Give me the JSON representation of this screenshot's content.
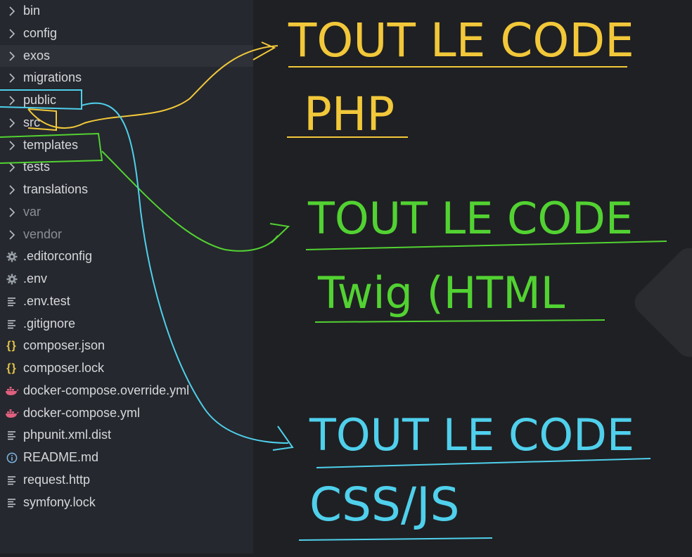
{
  "explorer": {
    "items": [
      {
        "label": "bin",
        "kind": "folder",
        "icon": "chevron-right-icon"
      },
      {
        "label": "config",
        "kind": "folder",
        "icon": "chevron-right-icon"
      },
      {
        "label": "exos",
        "kind": "folder",
        "icon": "chevron-right-icon",
        "active": true
      },
      {
        "label": "migrations",
        "kind": "folder",
        "icon": "chevron-right-icon"
      },
      {
        "label": "public",
        "kind": "folder",
        "icon": "chevron-right-icon"
      },
      {
        "label": "src",
        "kind": "folder",
        "icon": "chevron-right-icon"
      },
      {
        "label": "templates",
        "kind": "folder",
        "icon": "chevron-right-icon"
      },
      {
        "label": "tests",
        "kind": "folder",
        "icon": "chevron-right-icon"
      },
      {
        "label": "translations",
        "kind": "folder",
        "icon": "chevron-right-icon"
      },
      {
        "label": "var",
        "kind": "folder",
        "icon": "chevron-right-icon",
        "dim": true
      },
      {
        "label": "vendor",
        "kind": "folder",
        "icon": "chevron-right-icon",
        "dim": true
      },
      {
        "label": ".editorconfig",
        "kind": "file",
        "icon": "gear-icon"
      },
      {
        "label": ".env",
        "kind": "file",
        "icon": "gear-icon"
      },
      {
        "label": ".env.test",
        "kind": "file",
        "icon": "text-file-icon"
      },
      {
        "label": ".gitignore",
        "kind": "file",
        "icon": "text-file-icon"
      },
      {
        "label": "composer.json",
        "kind": "file",
        "icon": "json-braces-icon"
      },
      {
        "label": "composer.lock",
        "kind": "file",
        "icon": "json-braces-icon"
      },
      {
        "label": "docker-compose.override.yml",
        "kind": "file",
        "icon": "docker-whale-icon"
      },
      {
        "label": "docker-compose.yml",
        "kind": "file",
        "icon": "docker-whale-icon"
      },
      {
        "label": "phpunit.xml.dist",
        "kind": "file",
        "icon": "text-file-icon"
      },
      {
        "label": "README.md",
        "kind": "file",
        "icon": "info-icon"
      },
      {
        "label": "request.http",
        "kind": "file",
        "icon": "text-file-icon"
      },
      {
        "label": "symfony.lock",
        "kind": "file",
        "icon": "text-file-icon"
      }
    ]
  },
  "annotations": {
    "php": {
      "line1": "TOUT LE CODE",
      "line2": "PHP",
      "color": "#f2c83a"
    },
    "twig": {
      "line1": "TOUT LE CODE",
      "line2": "Twig (HTML",
      "color": "#52d232"
    },
    "css": {
      "line1": "TOUT LE CODE",
      "line2": "CSS/JS",
      "color": "#4fd0ec"
    }
  },
  "colors": {
    "sidebar_bg": "#25282e",
    "editor_bg": "#1f2023",
    "json_icon": "#e6c44a",
    "docker_icon": "#e0607e",
    "info_icon": "#7fb6e6",
    "gear_icon": "#9aa0a8"
  }
}
